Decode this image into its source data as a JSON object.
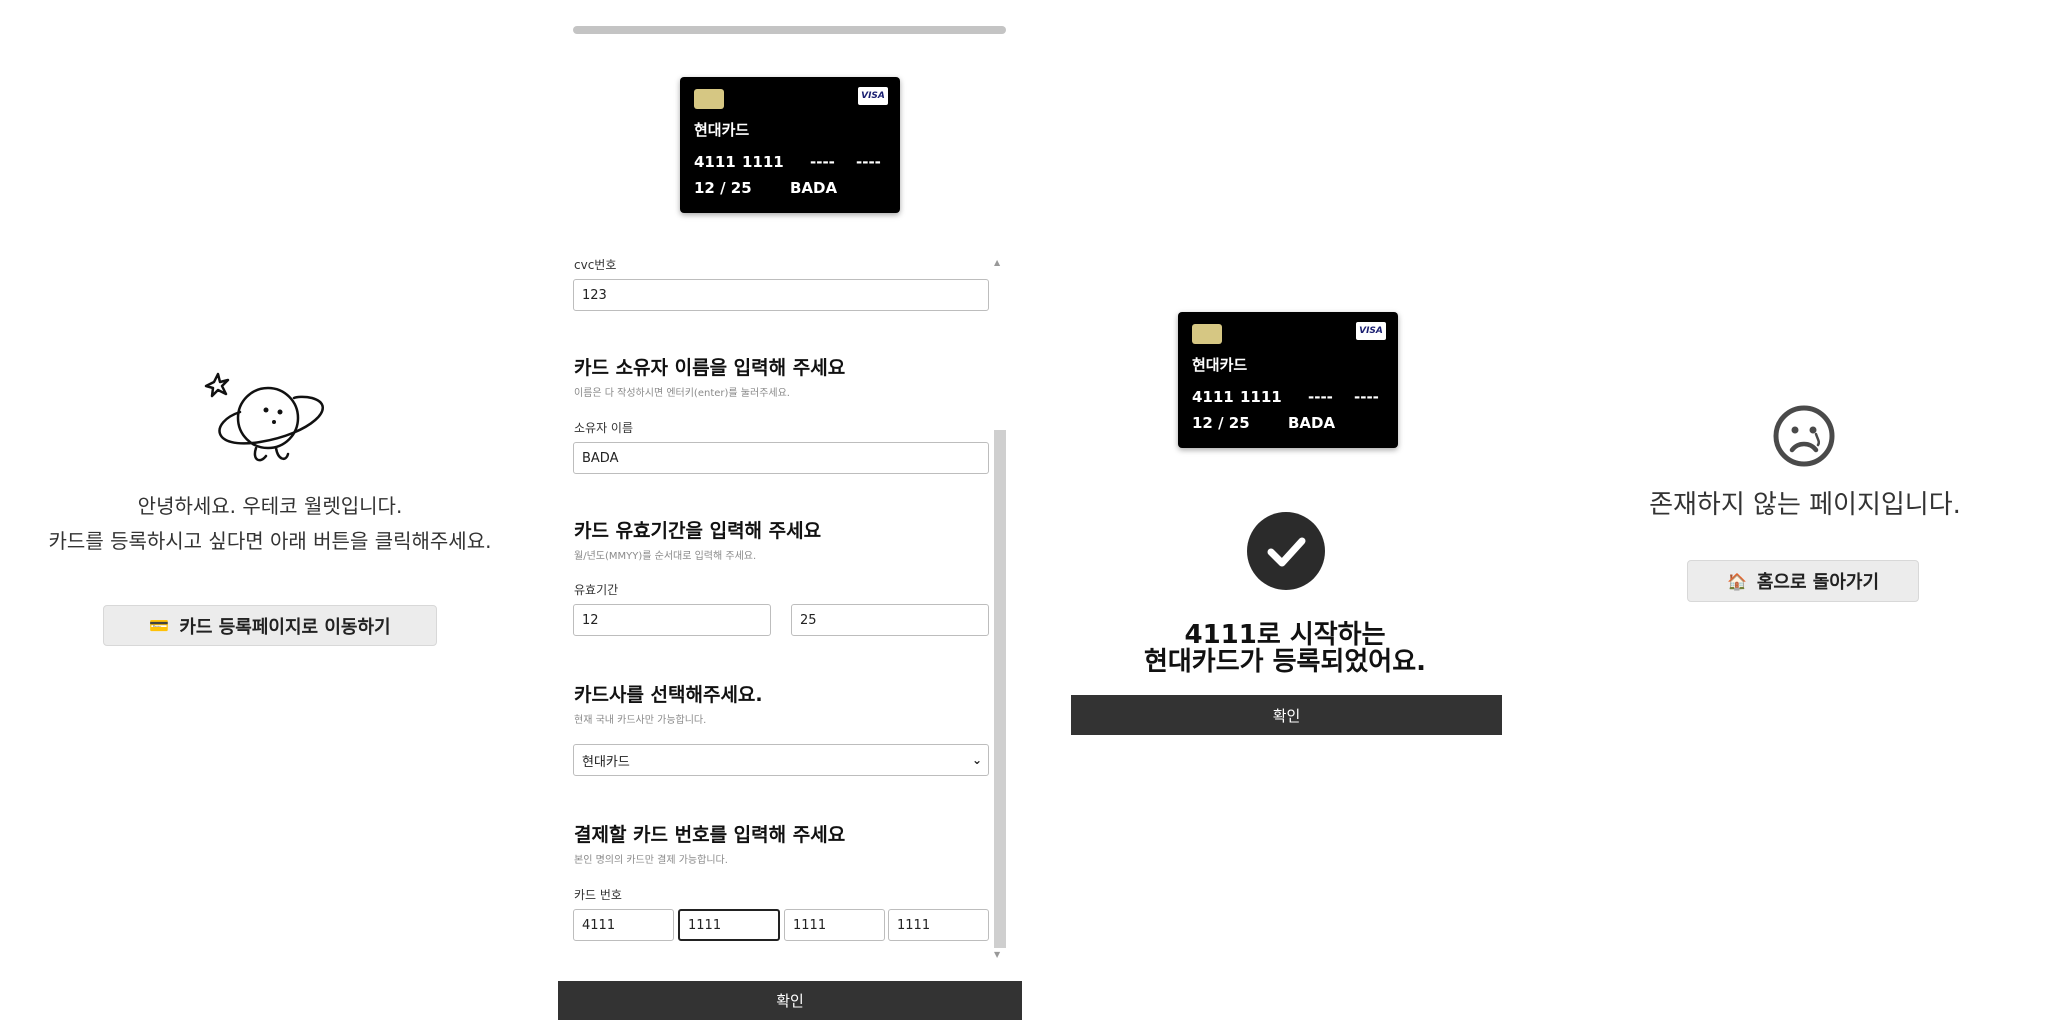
{
  "welcome": {
    "line1": "안녕하세요. 우테코 월렛입니다.",
    "line2": "카드를 등록하시고 싶다면 아래 버튼을 클릭해주세요.",
    "button_icon": "💳",
    "button_label": "카드 등록페이지로 이동하기"
  },
  "card_preview": {
    "company": "현대카드",
    "brand": "VISA",
    "num1": "4111",
    "num2": "1111",
    "num3": "----",
    "num4": "----",
    "expiry": "12 / 25",
    "owner": "BADA"
  },
  "form": {
    "cvc": {
      "label": "cvc번호",
      "value": "123"
    },
    "owner": {
      "title": "카드 소유자 이름을 입력해 주세요",
      "subtitle": "이름은 다 작성하시면 엔터키(enter)를 눌러주세요.",
      "label": "소유자 이름",
      "value": "BADA"
    },
    "expiry": {
      "title": "카드 유효기간을 입력해 주세요",
      "subtitle": "월/년도(MMYY)를 순서대로 입력해 주세요.",
      "label": "유효기간",
      "month": "12",
      "year": "25"
    },
    "company": {
      "title": "카드사를 선택해주세요.",
      "subtitle": "현재 국내 카드사만 가능합니다.",
      "selected": "현대카드"
    },
    "number": {
      "title": "결제할 카드 번호를 입력해 주세요",
      "subtitle": "본인 명의의 카드만 결제 가능합니다.",
      "label": "카드 번호",
      "values": [
        "4111",
        "1111",
        "1111",
        "1111"
      ]
    },
    "confirm_label": "확인"
  },
  "success": {
    "line1": "4111로 시작하는",
    "line2": "현대카드가 등록되었어요.",
    "confirm_label": "확인"
  },
  "not_found": {
    "message": "존재하지 않는 페이지입니다.",
    "button_icon": "🏠",
    "button_label": "홈으로 돌아가기"
  }
}
